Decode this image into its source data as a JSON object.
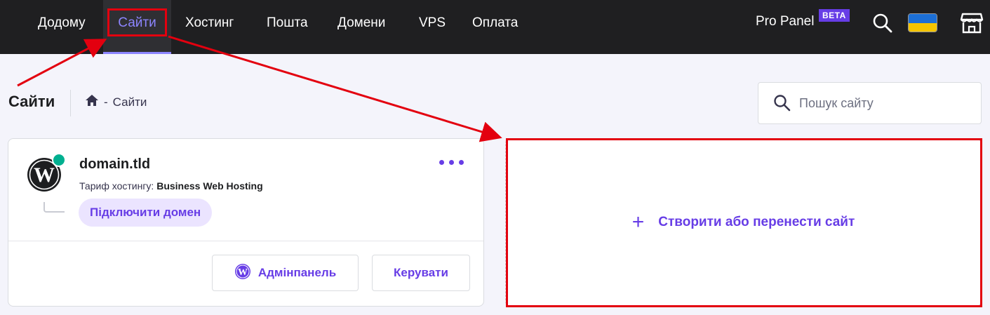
{
  "nav": {
    "items": [
      {
        "label": "Додому"
      },
      {
        "label": "Сайти"
      },
      {
        "label": "Хостинг"
      },
      {
        "label": "Пошта"
      },
      {
        "label": "Домени"
      },
      {
        "label": "VPS"
      },
      {
        "label": "Оплата"
      }
    ],
    "active_item": "Сайти",
    "pro_panel_label": "Pro Panel",
    "beta_badge": "BETA",
    "icons": [
      "search-icon",
      "ukraine-flag-icon",
      "store-icon"
    ]
  },
  "page": {
    "title": "Сайти",
    "breadcrumb": {
      "home_icon": "home-icon",
      "separator": "-",
      "current": "Сайти"
    },
    "search": {
      "placeholder": "Пошук сайту",
      "value": "",
      "icon": "search-icon"
    }
  },
  "site_card": {
    "domain": "domain.tld",
    "plan_label": "Тариф хостингу:",
    "plan_name": "Business Web Hosting",
    "status": "online",
    "connect_domain_label": "Підключити домен",
    "admin_button_label": "Адмінпанель",
    "manage_button_label": "Керувати",
    "more_icon": "more-dots-icon"
  },
  "create_site": {
    "label": "Створити або перенести сайт",
    "icon": "plus-icon"
  },
  "colors": {
    "topbar": "#1f1f21",
    "accent": "#673de6",
    "active_nav": "#8c85ff",
    "status_online": "#00b090",
    "annotation": "#e3000f"
  }
}
